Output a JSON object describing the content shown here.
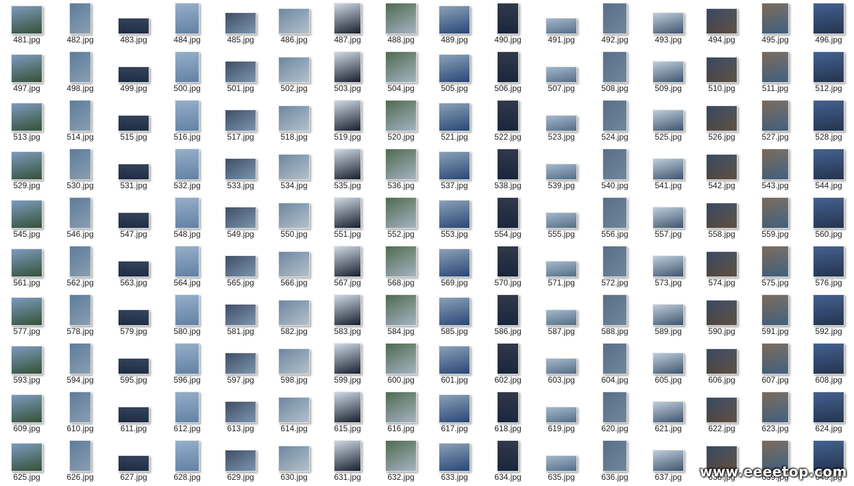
{
  "files": {
    "extension": ".jpg",
    "first_number": 481,
    "last_number": 640,
    "per_row": 16,
    "thumb_colors": [
      "#2d4f86",
      "#6d8fb8",
      "#4a6d8f",
      "#1c2b45",
      "#8aa6c2",
      "#2a3a55",
      "#5d7a96",
      "#c9d6e2",
      "#3c5a3c",
      "#7e96ad",
      "#1a2233",
      "#9ab0c6",
      "#465e7a",
      "#b8c8d8",
      "#23344f",
      "#6b5a4a"
    ]
  },
  "watermark": {
    "text": "www.eeeetop.com"
  }
}
